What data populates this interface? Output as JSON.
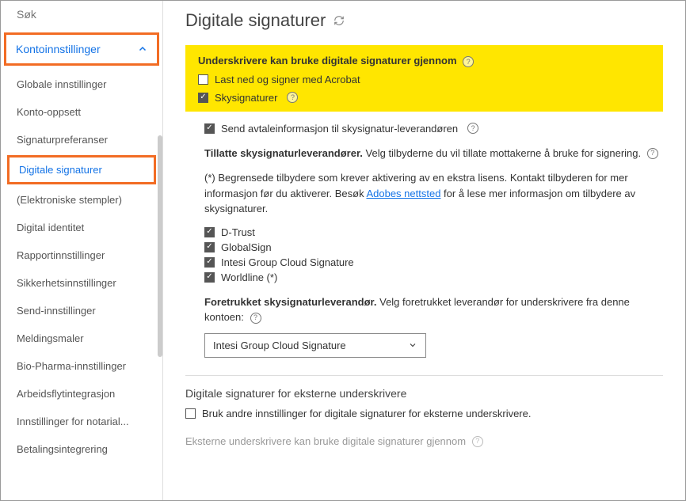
{
  "search": {
    "placeholder": "Søk"
  },
  "sidebar": {
    "accordion_label": "Kontoinnstillinger",
    "items": [
      {
        "label": "Globale innstillinger"
      },
      {
        "label": "Konto-oppsett"
      },
      {
        "label": "Signaturpreferanser"
      },
      {
        "label": "Digitale signaturer",
        "active": true
      },
      {
        "label": "(Elektroniske stempler)"
      },
      {
        "label": "Digital identitet"
      },
      {
        "label": "Rapportinnstillinger"
      },
      {
        "label": "Sikkerhetsinnstillinger"
      },
      {
        "label": "Send-innstillinger"
      },
      {
        "label": "Meldingsmaler"
      },
      {
        "label": "Bio-Pharma-innstillinger"
      },
      {
        "label": "Arbeidsflytintegrasjon"
      },
      {
        "label": "Innstillinger for notarial..."
      },
      {
        "label": "Betalingsintegrering"
      }
    ]
  },
  "main": {
    "title": "Digitale signaturer",
    "highlight": {
      "heading": "Underskrivere kan bruke digitale signaturer gjennom",
      "opt_acrobat": "Last ned og signer med Acrobat",
      "opt_cloud": "Skysignaturer"
    },
    "send_info": "Send avtaleinformasjon til skysignatur-leverandøren",
    "allowed_prefix": "Tillatte skysignaturleverandører.",
    "allowed_text": "Velg tilbyderne du vil tillate mottakerne å bruke for signering.",
    "note_pre": "(*) Begrensede tilbydere som krever aktivering av en ekstra lisens. Kontakt tilbyderen for mer informasjon før du aktiverer. Besøk ",
    "note_link": "Adobes nettsted",
    "note_post": " for å lese mer informasjon om tilbydere av skysignaturer.",
    "providers": [
      "D-Trust",
      "GlobalSign",
      "Intesi Group Cloud Signature",
      "Worldline (*)"
    ],
    "preferred_prefix": "Foretrukket skysignaturleverandør.",
    "preferred_text": "Velg foretrukket leverandør for underskrivere fra denne kontoen:",
    "preferred_selected": "Intesi Group Cloud Signature",
    "external_header": "Digitale signaturer for eksterne underskrivere",
    "external_opt": "Bruk andre innstillinger for digitale signaturer for eksterne underskrivere.",
    "external_faded": "Eksterne underskrivere kan bruke digitale signaturer gjennom"
  }
}
